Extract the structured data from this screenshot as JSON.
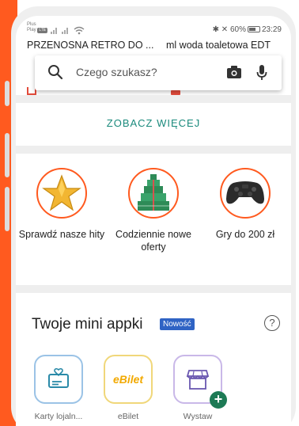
{
  "status_bar": {
    "carrier_line1": "Plus",
    "carrier_line2": "Play",
    "carrier_tag": "LTE",
    "battery": "60%",
    "time": "23:29"
  },
  "recent_searches": [
    "PRZENOSNA RETRO DO ...",
    "ml woda toaletowa EDT"
  ],
  "search": {
    "placeholder": "Czego szukasz?"
  },
  "see_more_label": "ZOBACZ WIĘCEJ",
  "promos": [
    {
      "label": "Sprawdź nasze hity",
      "icon": "star-icon"
    },
    {
      "label": "Codziennie nowe oferty",
      "icon": "gift-tree-icon"
    },
    {
      "label": "Gry do 200 zł",
      "icon": "gamepad-icon"
    }
  ],
  "mini_apps": {
    "title": "Twoje mini appki",
    "badge": "Nowość",
    "help": "?",
    "items": [
      {
        "name": "Karty lojaln...",
        "icon": "loyalty-card-icon",
        "border": "#9bc3e6"
      },
      {
        "name": "eBilet",
        "icon": "ebilet-logo",
        "logo_text": "eBilet",
        "border": "#f0d77a"
      },
      {
        "name": "Wystaw",
        "icon": "shop-icon",
        "border": "#c9b8e8",
        "plus": "+"
      }
    ]
  },
  "colors": {
    "accent_orange": "#ff5a1f",
    "link_teal": "#1a8a7c",
    "badge_blue": "#2f63c4",
    "plus_green": "#1d7a55"
  }
}
